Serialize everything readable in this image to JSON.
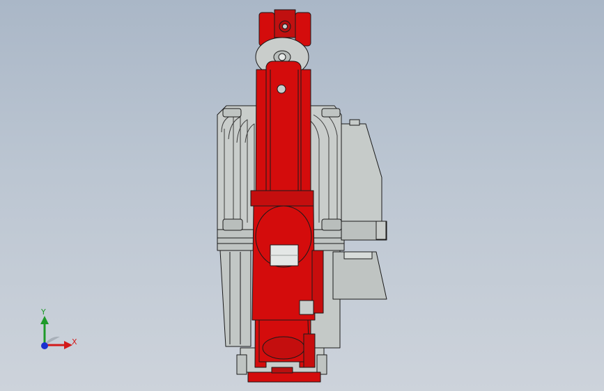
{
  "viewport": {
    "background_top": "#aab7c7",
    "background_bottom": "#cdd3db"
  },
  "model": {
    "part_color_red": "#d40c0c",
    "part_color_gray": "#c9cdcb",
    "edge_color": "#1a1a1a"
  },
  "triad": {
    "y_label": "Y",
    "x_label": "X",
    "y_color": "#1f9a2a",
    "x_color": "#d21a1a",
    "z_color": "#1a2fd0"
  }
}
